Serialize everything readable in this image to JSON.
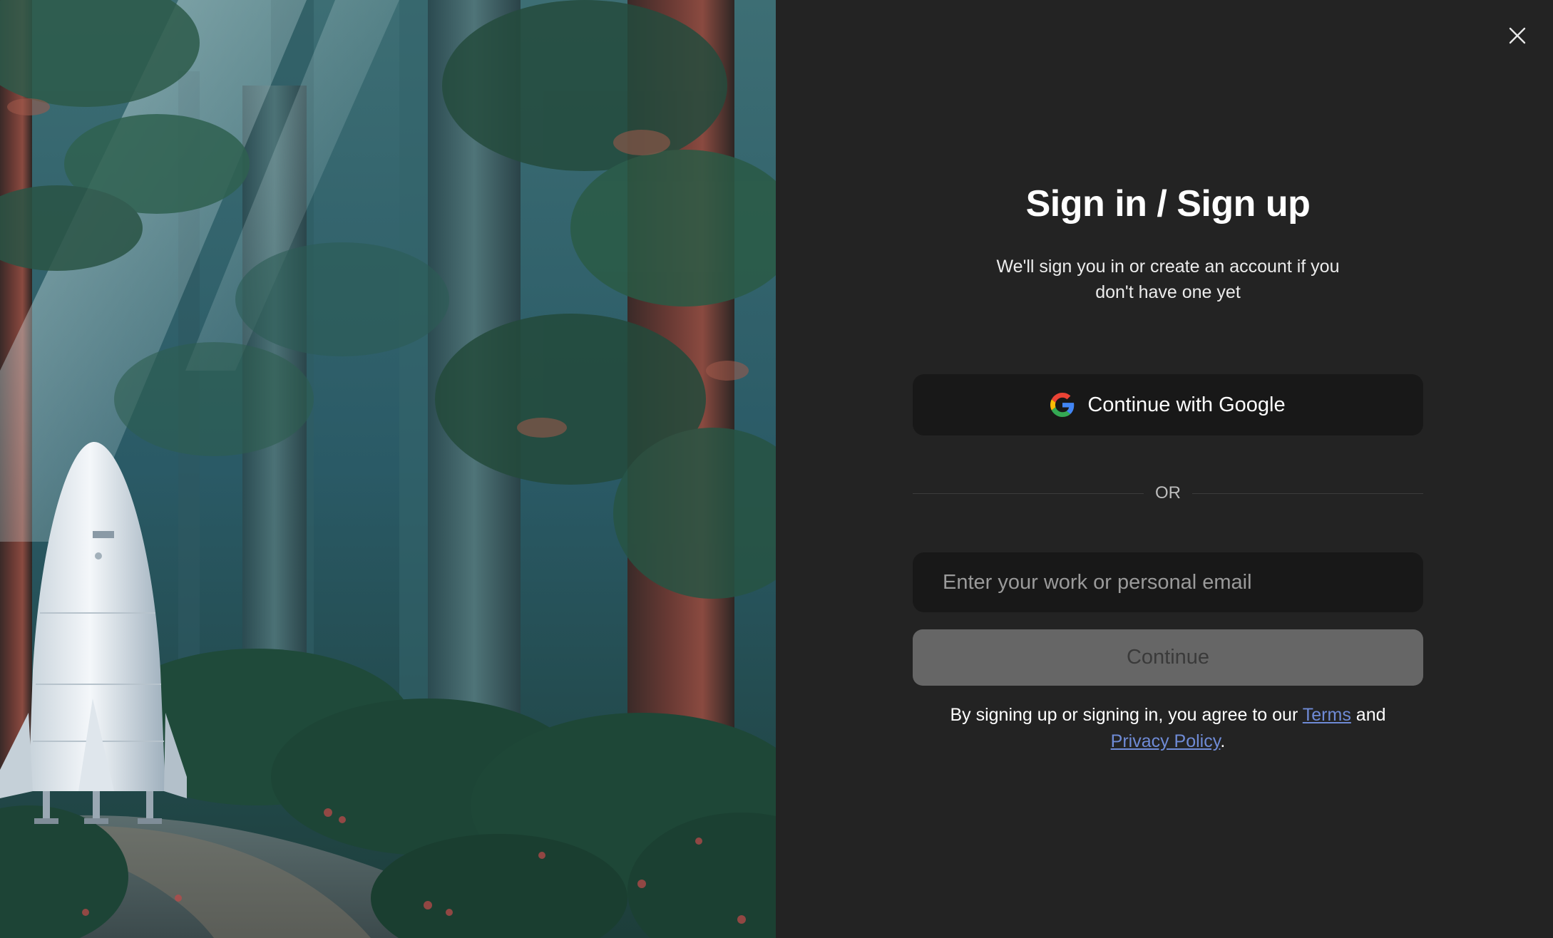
{
  "dialog": {
    "title": "Sign in / Sign up",
    "subtitle": "We'll sign you in or create an account if you don't have one yet",
    "close_icon": "close-icon"
  },
  "google": {
    "label": "Continue with Google",
    "icon": "google-logo-icon"
  },
  "divider": {
    "label": "OR"
  },
  "email": {
    "placeholder": "Enter your work or personal email",
    "value": ""
  },
  "continue": {
    "label": "Continue",
    "enabled": false
  },
  "legal": {
    "prefix": "By signing up or signing in, you agree to our",
    "terms_link": "Terms",
    "conjunction": "and",
    "privacy_link": "Privacy Policy",
    "suffix": "."
  },
  "colors": {
    "panel_bg": "#232323",
    "button_bg": "#181818",
    "continue_disabled_bg": "#666666",
    "link": "#6f8bd6"
  }
}
